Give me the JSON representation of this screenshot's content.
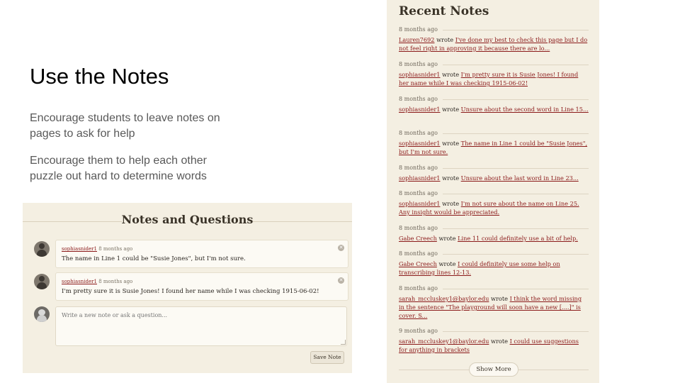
{
  "slide": {
    "title": "Use the Notes",
    "bullets": [
      "Encourage students to leave notes on pages to ask for help",
      "Encourage them to help each other puzzle out hard to determine words"
    ]
  },
  "notes_panel": {
    "title": "Notes and Questions",
    "notes": [
      {
        "user": "sophiasnider1",
        "time": "8 months ago",
        "text": "The name in Line 1 could be \"Susie Jones\", but I'm not sure."
      },
      {
        "user": "sophiasnider1",
        "time": "8 months ago",
        "text": "I'm pretty sure it is Susie Jones! I found her name while I was checking 1915-06-02!"
      }
    ],
    "new_note_placeholder": "Write a new note or ask a question...",
    "save_label": "Save Note"
  },
  "recent_notes": {
    "title": "Recent Notes",
    "wrote": "wrote",
    "items": [
      {
        "time": "8 months ago",
        "user": "Lauren7692",
        "text": "I've done my best to check this page but I do not feel right in approving it because there are lo..."
      },
      {
        "time": "8 months ago",
        "user": "sophiasnider1",
        "text": "I'm pretty sure it is Susie Jones! I found her name while I was checking 1915-06-02!"
      },
      {
        "time": "8 months ago",
        "user": "sophiasnider1",
        "text": "Unsure about the second word in Line 15..."
      },
      {
        "time": "8 months ago",
        "user": "sophiasnider1",
        "text": "The name in Line 1 could be \"Susie Jones\", but I'm not sure."
      },
      {
        "time": "8 months ago",
        "user": "sophiasnider1",
        "text": "Unsure about the last word in Line 23..."
      },
      {
        "time": "8 months ago",
        "user": "sophiasnider1",
        "text": "I'm not sure about the name on Line 25. Any insight would be appreciated."
      },
      {
        "time": "8 months ago",
        "user": "Gabe Creech",
        "text": "Line 11 could definitely use a bit of help."
      },
      {
        "time": "8 months ago",
        "user": "Gabe Creech",
        "text": "I could definitely use some help on transcribing lines 12-13."
      },
      {
        "time": "8 months ago",
        "user": "sarah_mccluskey1@baylor.edu",
        "text": "I think the word missing in the sentence \"The playground will soon have a new [....]\" is cover. S..."
      },
      {
        "time": "9 months ago",
        "user": "sarah_mccluskey1@baylor.edu",
        "text": "I could use suggestions for anything in brackets"
      }
    ],
    "show_more_label": "Show More"
  },
  "colors": {
    "panel_bg": "#f4efe2",
    "link": "#8b1a1a"
  },
  "icons": [
    "user-avatar-icon",
    "close-icon"
  ]
}
